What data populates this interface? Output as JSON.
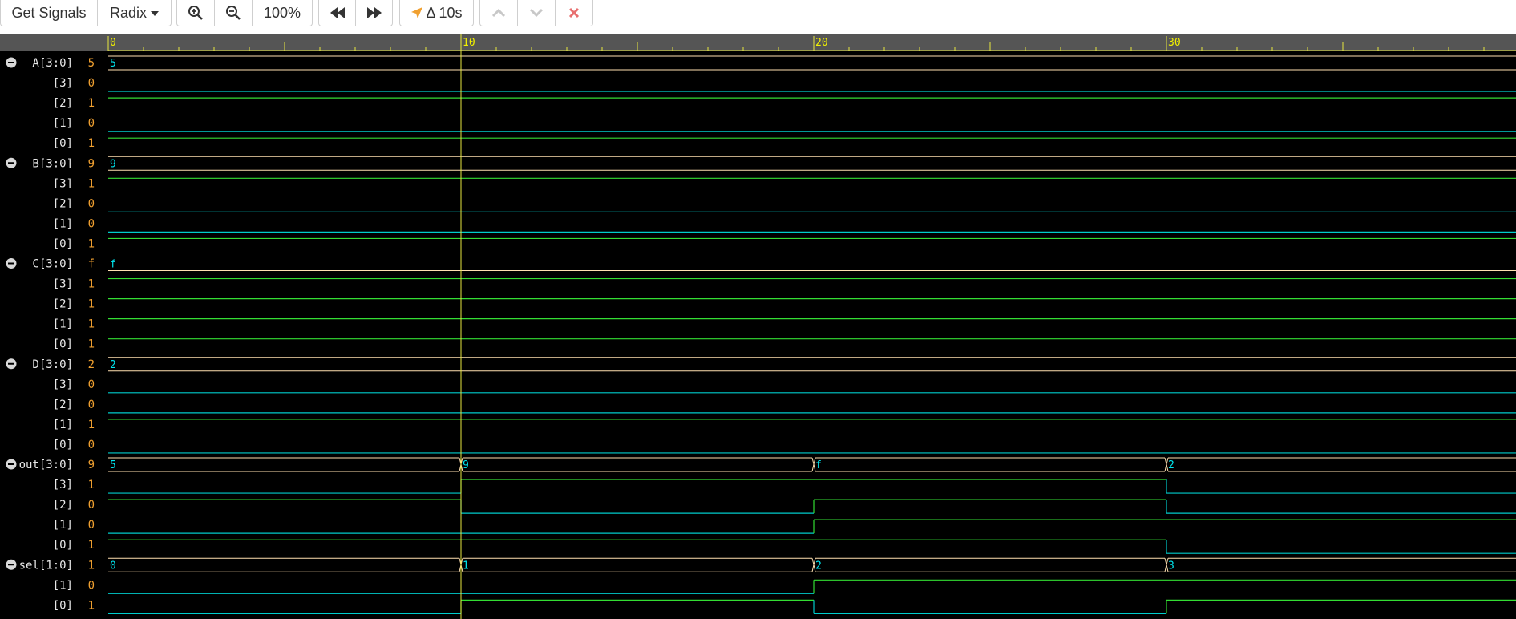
{
  "toolbar": {
    "get_signals": "Get Signals",
    "radix": "Radix",
    "zoom_in_icon": "⊕",
    "zoom_out_icon": "⊖",
    "zoom_level": "100%",
    "rewind_icon": "⏪",
    "forward_icon": "⏩",
    "delta_icon": "➤",
    "delta_label": "Δ 10s",
    "up_icon": "︿",
    "down_icon": "﹀",
    "close_icon": "✖"
  },
  "colors": {
    "toolbar_bg": "#ffffff",
    "wave_bg": "#000000",
    "ruler": "#555555",
    "bus": "#ffe0b0",
    "high": "#33dd33",
    "low": "#00cccc",
    "cursor": "#e8e840",
    "value": "#f0a030",
    "bus_text": "#00e5ee"
  },
  "timeline": {
    "max_time": 40,
    "cursor_time": 10,
    "major_ticks": [
      0,
      10,
      20,
      30
    ]
  },
  "signals": [
    {
      "type": "bus",
      "name": "A[3:0]",
      "value": "5",
      "segments": [
        {
          "t": 0,
          "v": "5"
        }
      ]
    },
    {
      "type": "bit",
      "name": "[3]",
      "value": "0",
      "transitions": [
        [
          0,
          0
        ]
      ]
    },
    {
      "type": "bit",
      "name": "[2]",
      "value": "1",
      "transitions": [
        [
          0,
          1
        ]
      ]
    },
    {
      "type": "bit",
      "name": "[1]",
      "value": "0",
      "transitions": [
        [
          0,
          0
        ]
      ]
    },
    {
      "type": "bit",
      "name": "[0]",
      "value": "1",
      "transitions": [
        [
          0,
          1
        ]
      ]
    },
    {
      "type": "bus",
      "name": "B[3:0]",
      "value": "9",
      "segments": [
        {
          "t": 0,
          "v": "9"
        }
      ]
    },
    {
      "type": "bit",
      "name": "[3]",
      "value": "1",
      "transitions": [
        [
          0,
          1
        ]
      ]
    },
    {
      "type": "bit",
      "name": "[2]",
      "value": "0",
      "transitions": [
        [
          0,
          0
        ]
      ]
    },
    {
      "type": "bit",
      "name": "[1]",
      "value": "0",
      "transitions": [
        [
          0,
          0
        ]
      ]
    },
    {
      "type": "bit",
      "name": "[0]",
      "value": "1",
      "transitions": [
        [
          0,
          1
        ]
      ]
    },
    {
      "type": "bus",
      "name": "C[3:0]",
      "value": "f",
      "segments": [
        {
          "t": 0,
          "v": "f"
        }
      ]
    },
    {
      "type": "bit",
      "name": "[3]",
      "value": "1",
      "transitions": [
        [
          0,
          1
        ]
      ]
    },
    {
      "type": "bit",
      "name": "[2]",
      "value": "1",
      "transitions": [
        [
          0,
          1
        ]
      ]
    },
    {
      "type": "bit",
      "name": "[1]",
      "value": "1",
      "transitions": [
        [
          0,
          1
        ]
      ]
    },
    {
      "type": "bit",
      "name": "[0]",
      "value": "1",
      "transitions": [
        [
          0,
          1
        ]
      ]
    },
    {
      "type": "bus",
      "name": "D[3:0]",
      "value": "2",
      "segments": [
        {
          "t": 0,
          "v": "2"
        }
      ]
    },
    {
      "type": "bit",
      "name": "[3]",
      "value": "0",
      "transitions": [
        [
          0,
          0
        ]
      ]
    },
    {
      "type": "bit",
      "name": "[2]",
      "value": "0",
      "transitions": [
        [
          0,
          0
        ]
      ]
    },
    {
      "type": "bit",
      "name": "[1]",
      "value": "1",
      "transitions": [
        [
          0,
          1
        ]
      ]
    },
    {
      "type": "bit",
      "name": "[0]",
      "value": "0",
      "transitions": [
        [
          0,
          0
        ]
      ]
    },
    {
      "type": "bus",
      "name": "out[3:0]",
      "value": "9",
      "segments": [
        {
          "t": 0,
          "v": "5"
        },
        {
          "t": 10,
          "v": "9"
        },
        {
          "t": 20,
          "v": "f"
        },
        {
          "t": 30,
          "v": "2"
        }
      ]
    },
    {
      "type": "bit",
      "name": "[3]",
      "value": "1",
      "transitions": [
        [
          0,
          0
        ],
        [
          10,
          1
        ],
        [
          30,
          0
        ]
      ]
    },
    {
      "type": "bit",
      "name": "[2]",
      "value": "0",
      "transitions": [
        [
          0,
          1
        ],
        [
          10,
          0
        ],
        [
          20,
          1
        ],
        [
          30,
          0
        ]
      ]
    },
    {
      "type": "bit",
      "name": "[1]",
      "value": "0",
      "transitions": [
        [
          0,
          0
        ],
        [
          20,
          1
        ]
      ]
    },
    {
      "type": "bit",
      "name": "[0]",
      "value": "1",
      "transitions": [
        [
          0,
          1
        ],
        [
          30,
          0
        ]
      ]
    },
    {
      "type": "bus",
      "name": "sel[1:0]",
      "value": "1",
      "segments": [
        {
          "t": 0,
          "v": "0"
        },
        {
          "t": 10,
          "v": "1"
        },
        {
          "t": 20,
          "v": "2"
        },
        {
          "t": 30,
          "v": "3"
        }
      ]
    },
    {
      "type": "bit",
      "name": "[1]",
      "value": "0",
      "transitions": [
        [
          0,
          0
        ],
        [
          20,
          1
        ]
      ]
    },
    {
      "type": "bit",
      "name": "[0]",
      "value": "1",
      "transitions": [
        [
          0,
          0
        ],
        [
          10,
          1
        ],
        [
          20,
          0
        ],
        [
          30,
          1
        ]
      ]
    }
  ]
}
